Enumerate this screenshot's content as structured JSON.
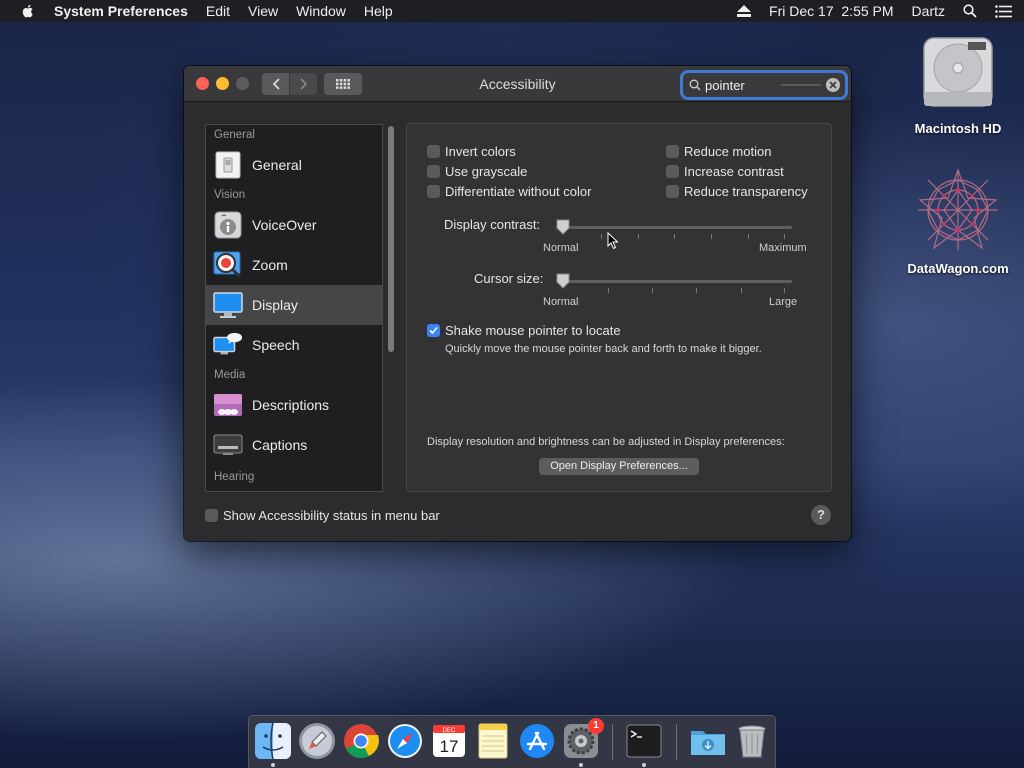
{
  "menubar": {
    "app_name": "System Preferences",
    "items": [
      "Edit",
      "View",
      "Window",
      "Help"
    ],
    "datetime": "Fri Dec 17  2:55 PM",
    "user": "Dartz"
  },
  "desktop": {
    "icons": [
      {
        "label": "Macintosh HD",
        "icon": "hard-drive-icon"
      },
      {
        "label": "DataWagon.com",
        "icon": "geometric-star-icon"
      }
    ]
  },
  "window": {
    "title": "Accessibility",
    "search": {
      "value": "pointer",
      "placeholder": "Search"
    }
  },
  "sidebar": {
    "sections": [
      {
        "header": "General",
        "items": [
          {
            "label": "General",
            "icon": "switch-icon",
            "selected": false
          }
        ]
      },
      {
        "header": "Vision",
        "items": [
          {
            "label": "VoiceOver",
            "icon": "voiceover-icon",
            "selected": false
          },
          {
            "label": "Zoom",
            "icon": "zoom-icon",
            "selected": false
          },
          {
            "label": "Display",
            "icon": "display-icon",
            "selected": true
          },
          {
            "label": "Speech",
            "icon": "speech-icon",
            "selected": false
          }
        ]
      },
      {
        "header": "Media",
        "items": [
          {
            "label": "Descriptions",
            "icon": "descriptions-icon",
            "selected": false
          },
          {
            "label": "Captions",
            "icon": "captions-icon",
            "selected": false
          }
        ]
      },
      {
        "header": "Hearing",
        "items": []
      }
    ]
  },
  "display": {
    "checkboxes_left": [
      {
        "label": "Invert colors",
        "checked": false
      },
      {
        "label": "Use grayscale",
        "checked": false
      },
      {
        "label": "Differentiate without color",
        "checked": false
      }
    ],
    "checkboxes_right": [
      {
        "label": "Reduce motion",
        "checked": false
      },
      {
        "label": "Increase contrast",
        "checked": false
      },
      {
        "label": "Reduce transparency",
        "checked": false
      }
    ],
    "contrast": {
      "label": "Display contrast:",
      "min_label": "Normal",
      "max_label": "Maximum",
      "value": 0
    },
    "cursor_size": {
      "label": "Cursor size:",
      "min_label": "Normal",
      "max_label": "Large",
      "value": 0
    },
    "shake": {
      "label": "Shake mouse pointer to locate",
      "checked": true,
      "description": "Quickly move the mouse pointer back and forth to make it bigger."
    },
    "footer_text": "Display resolution and brightness can be adjusted in Display preferences:",
    "open_button": "Open Display Preferences..."
  },
  "bottom": {
    "status_checkbox": "Show Accessibility status in menu bar",
    "status_checked": false,
    "help_label": "?"
  },
  "dock": {
    "items": [
      {
        "icon": "finder-icon",
        "running": true
      },
      {
        "icon": "launchpad-icon",
        "running": false
      },
      {
        "icon": "chrome-icon",
        "running": false
      },
      {
        "icon": "safari-icon",
        "running": false
      },
      {
        "icon": "calendar-icon",
        "running": false,
        "month": "DEC",
        "day": "17"
      },
      {
        "icon": "notes-icon",
        "running": false
      },
      {
        "icon": "app-store-icon",
        "running": false
      },
      {
        "icon": "system-preferences-icon",
        "running": true,
        "badge": "1"
      },
      {
        "icon": "terminal-icon",
        "running": true
      },
      {
        "icon": "downloads-folder-icon",
        "running": false
      },
      {
        "icon": "trash-icon",
        "running": false
      }
    ]
  }
}
